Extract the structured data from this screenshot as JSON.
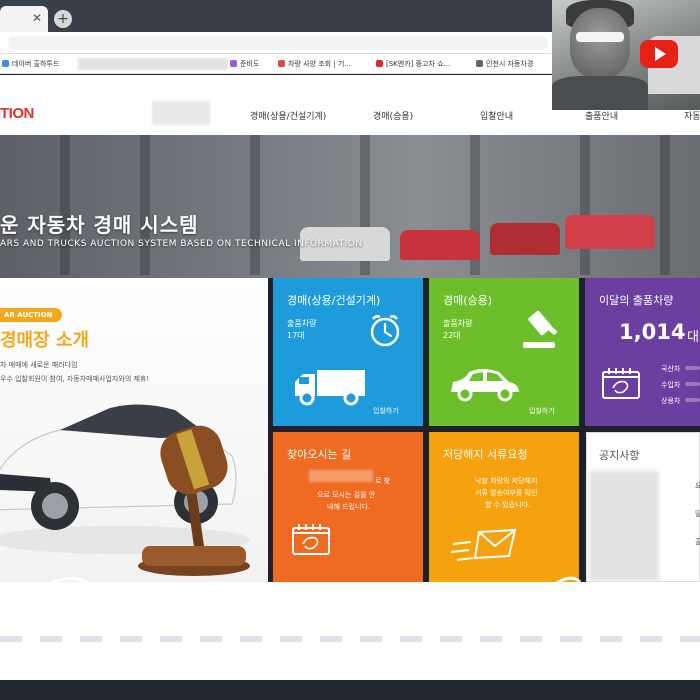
{
  "browser": {
    "bookmarks": [
      {
        "label": "데이버 출하투드",
        "color": "#3c8fe6"
      },
      {
        "label": "준비도",
        "color": "#9b59d6"
      },
      {
        "label": "차량 사양 조회 | 기...",
        "color": "#e04a3c"
      },
      {
        "label": "[SK엔카] 중고차 쇼...",
        "color": "#d9302a"
      },
      {
        "label": "인천시 자동차경",
        "color": "#666666"
      }
    ]
  },
  "site": {
    "logo_text": "TION",
    "nav": [
      "경매(상용/건설기계)",
      "경매(승용)",
      "입찰안내",
      "출품안내",
      "자동"
    ]
  },
  "hero": {
    "title": "운 자동차 경매 시스템",
    "subtitle": "ARS AND TRUCKS AUCTION SYSTEM BASED ON TECHNICAL INFORMATION"
  },
  "intro": {
    "badge": "AR AUCTION",
    "title": "경매장 소개",
    "desc_line1": "차 매매에 새로운 패러다임",
    "desc_line2": "우수 입찰회원이 참여, 자동차매매사업자와의 제휴!"
  },
  "tiles": {
    "commercial": {
      "title": "경매(상용/건설기계)",
      "label": "출품차량",
      "count": "17대",
      "link": "입찰하기",
      "color": "#1e9bdb"
    },
    "passenger": {
      "title": "경매(승용)",
      "label": "출품차량",
      "count": "22대",
      "link": "입찰하기",
      "color": "#6cbf2b"
    },
    "monthly": {
      "title": "이달의 출품차량",
      "count": "1,014",
      "unit": "대",
      "items": [
        "국산차",
        "수입차",
        "상용차"
      ],
      "color": "#6b3fa0"
    },
    "directions": {
      "title": "찾아오시는 길",
      "line1": "로 찾",
      "line2": "으로 모시는 길을 안",
      "line3": "내해 드립니다.",
      "color": "#f06b22"
    },
    "mortgage": {
      "title": "저당해지 서류요청",
      "line1": "낙찰 차량의 저당해지",
      "line2": "서류 발송여부를 확인",
      "line3": "할 수 있습니다.",
      "color": "#f5a20e"
    },
    "notice": {
      "title": "공지사항",
      "items": [
        "요",
        "밀워",
        "출원"
      ]
    }
  }
}
